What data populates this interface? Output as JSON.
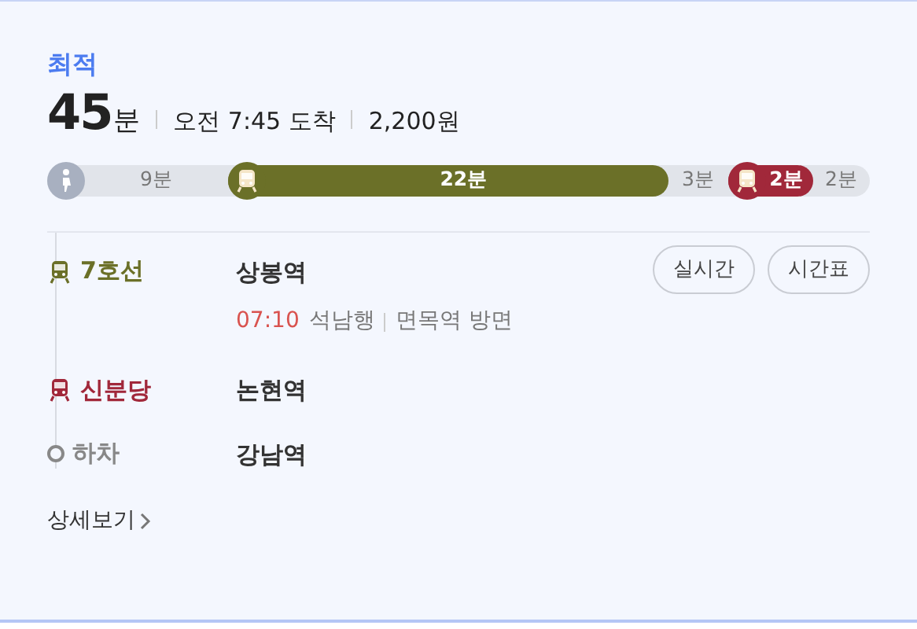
{
  "badge": "최적",
  "summary": {
    "duration": "45",
    "duration_unit": "분",
    "arrival": "오전 7:45 도착",
    "fare": "2,200원"
  },
  "segments": [
    {
      "kind": "walk",
      "label": "9분"
    },
    {
      "kind": "ride",
      "label": "22분",
      "color": "#6b7028"
    },
    {
      "kind": "wait",
      "label": "3분"
    },
    {
      "kind": "ride",
      "label": "2분",
      "color": "#a1283a"
    },
    {
      "kind": "wait",
      "label": "2분"
    }
  ],
  "steps": [
    {
      "kind": "ride",
      "line": "7호선",
      "color": "#6b7028",
      "station": "상봉역",
      "time": "07:10",
      "destination": "석남행",
      "direction": "면목역 방면",
      "buttons": [
        "실시간",
        "시간표"
      ]
    },
    {
      "kind": "ride",
      "line": "신분당",
      "color": "#a1283a",
      "station": "논현역"
    },
    {
      "kind": "alight",
      "line": "하차",
      "station": "강남역"
    }
  ],
  "details_link": "상세보기"
}
